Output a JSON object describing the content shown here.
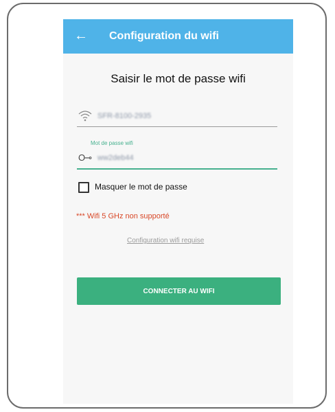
{
  "app_bar": {
    "back_icon": "arrow-left-icon",
    "back_glyph": "←",
    "title": "Configuration du wifi"
  },
  "heading": "Saisir le mot de passe wifi",
  "ssid_field": {
    "icon": "wifi-icon",
    "value": "SFR-8100-2935"
  },
  "password_field": {
    "icon": "key-icon",
    "icon_glyph": "O⊸",
    "label": "Mot de passe wifi",
    "value": "ww2deb44"
  },
  "hide_password": {
    "label": "Masquer le mot de passe",
    "checked": false
  },
  "warning": "*** Wifi 5 GHz non supporté",
  "config_link": "Configuration wifi requise",
  "connect_button": "CONNECTER AU WIFI",
  "colors": {
    "app_bar": "#4fb3e8",
    "accent": "#45b08e",
    "button": "#3bb07f",
    "warning": "#d84727"
  }
}
